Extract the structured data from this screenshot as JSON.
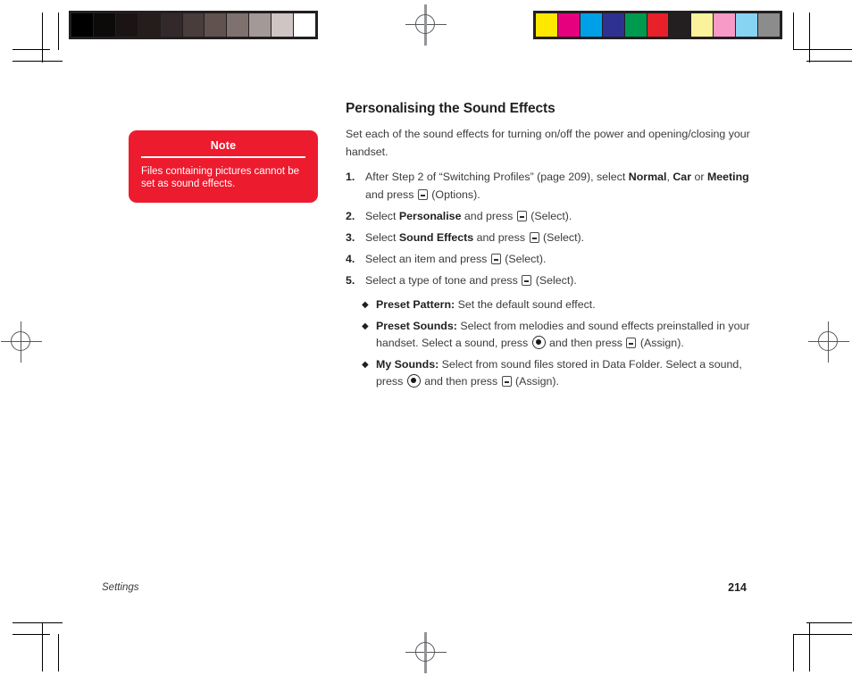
{
  "document": {
    "title": "Personalising the Sound Effects",
    "lead": "Set each of the sound effects for turning on/off the power and opening/closing your handset.",
    "footer_section": "Settings",
    "footer_page_number": "214"
  },
  "note": {
    "title": "Note",
    "text": "Files containing pictures cannot be set as sound effects."
  },
  "steps": [
    {
      "number": "1.",
      "parts": [
        {
          "text": "After Step 2 of “Switching Profiles” (page 209), select ",
          "style": "normal"
        },
        {
          "text": "Normal",
          "style": "bold"
        },
        {
          "text": ", ",
          "style": "normal"
        },
        {
          "text": "Car",
          "style": "bold"
        },
        {
          "text": " or ",
          "style": "normal"
        },
        {
          "text": "Meeting",
          "style": "bold"
        },
        {
          "text": " and press ",
          "style": "normal"
        },
        {
          "text": "",
          "style": "key-soft"
        },
        {
          "text": " (Options).",
          "style": "normal"
        }
      ]
    },
    {
      "number": "2.",
      "parts": [
        {
          "text": "Select ",
          "style": "normal"
        },
        {
          "text": "Personalise",
          "style": "bold"
        },
        {
          "text": " and press ",
          "style": "normal"
        },
        {
          "text": "",
          "style": "key-soft"
        },
        {
          "text": " (Select).",
          "style": "normal"
        }
      ]
    },
    {
      "number": "3.",
      "parts": [
        {
          "text": "Select ",
          "style": "normal"
        },
        {
          "text": "Sound Effects",
          "style": "bold"
        },
        {
          "text": " and press ",
          "style": "normal"
        },
        {
          "text": "",
          "style": "key-soft"
        },
        {
          "text": " (Select).",
          "style": "normal"
        }
      ]
    },
    {
      "number": "4.",
      "parts": [
        {
          "text": "Select an item and press ",
          "style": "normal"
        },
        {
          "text": "",
          "style": "key-soft"
        },
        {
          "text": " (Select).",
          "style": "normal"
        }
      ]
    },
    {
      "number": "5.",
      "parts": [
        {
          "text": "Select a type of tone and press ",
          "style": "normal"
        },
        {
          "text": "",
          "style": "key-soft"
        },
        {
          "text": " (Select).",
          "style": "normal"
        }
      ]
    }
  ],
  "bullets": [
    {
      "glyph": "◆",
      "term": "Preset Pattern:",
      "parts": [
        {
          "text": " Set the default sound effect.",
          "style": "normal"
        }
      ]
    },
    {
      "glyph": "◆",
      "term": "Preset Sounds:",
      "parts": [
        {
          "text": " Select from melodies and sound effects preinstalled in your handset. Select a sound, press ",
          "style": "normal"
        },
        {
          "text": "",
          "style": "key-center"
        },
        {
          "text": " and then press ",
          "style": "normal"
        },
        {
          "text": "",
          "style": "key-soft"
        },
        {
          "text": " (Assign).",
          "style": "normal"
        }
      ]
    },
    {
      "glyph": "◆",
      "term": "My Sounds:",
      "parts": [
        {
          "text": " Select from sound files stored in Data Folder. Select a sound, press ",
          "style": "normal"
        },
        {
          "text": "",
          "style": "key-center"
        },
        {
          "text": " and then press ",
          "style": "normal"
        },
        {
          "text": "",
          "style": "key-soft"
        },
        {
          "text": " (Assign).",
          "style": "normal"
        }
      ]
    }
  ],
  "print_marks": {
    "grayscale_bar": {
      "name": "grayscale-step-wedge",
      "patches": [
        "#000000",
        "#0d0a0a",
        "#1a1514",
        "#241d1c",
        "#33292a",
        "#483c3c",
        "#61524f",
        "#7f716e",
        "#a39a97",
        "#cfc6c4",
        "#ffffff"
      ]
    },
    "color_bar": {
      "name": "color-control-bar",
      "patches": [
        "#ffe800",
        "#e6007e",
        "#00a0e9",
        "#2e3192",
        "#009a4e",
        "#e8202a",
        "#231f20",
        "#fbf39c",
        "#f79ac7",
        "#87d3f2",
        "#8c8c8c"
      ]
    },
    "registration_mark_label": "registration-target",
    "crop_mark_label": "crop-mark"
  }
}
